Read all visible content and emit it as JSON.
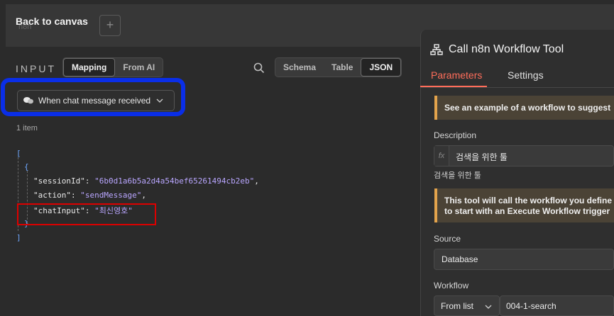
{
  "header": {
    "back_label": "Back to canvas",
    "ghost_text": "n8n",
    "plus_label": "+"
  },
  "input_panel": {
    "title": "INPUT",
    "mapping_tabs": [
      "Mapping",
      "From AI"
    ],
    "view_tabs": [
      "Schema",
      "Table",
      "JSON"
    ],
    "trigger_label": "When chat message received",
    "item_count": "1 item",
    "json_lines": {
      "open_array": "[",
      "open_obj": "{",
      "session_key": "\"sessionId\": ",
      "session_val": "\"6b0d1a6b5a2d4a54bef65261494cb2eb\"",
      "session_comma": ",",
      "action_key": "\"action\": ",
      "action_val": "\"sendMessage\"",
      "action_comma": ",",
      "chat_key": "\"chatInput\": ",
      "chat_val": "\"최신영호\"",
      "close_obj": "}",
      "close_array": "]"
    }
  },
  "node_panel": {
    "title": "Call n8n Workflow Tool",
    "tabs": [
      "Parameters",
      "Settings"
    ],
    "notice1": "See an example of a workflow to suggest",
    "description_label": "Description",
    "fx_label": "fx",
    "description_value": "검색을 위한 툴",
    "description_preview": "검색을 위한 툴",
    "notice2_line1": "This tool will call the workflow you define i",
    "notice2_line2": "to start with an Execute Workflow trigger",
    "source_label": "Source",
    "source_value": "Database",
    "workflow_label": "Workflow",
    "workflow_mode": "From list",
    "workflow_value": "004-1-search"
  },
  "colors": {
    "accent": "#ff6d5a",
    "annotation_blue": "#0a2ee8",
    "annotation_red": "#dd0000",
    "warning": "#e3a34c"
  }
}
